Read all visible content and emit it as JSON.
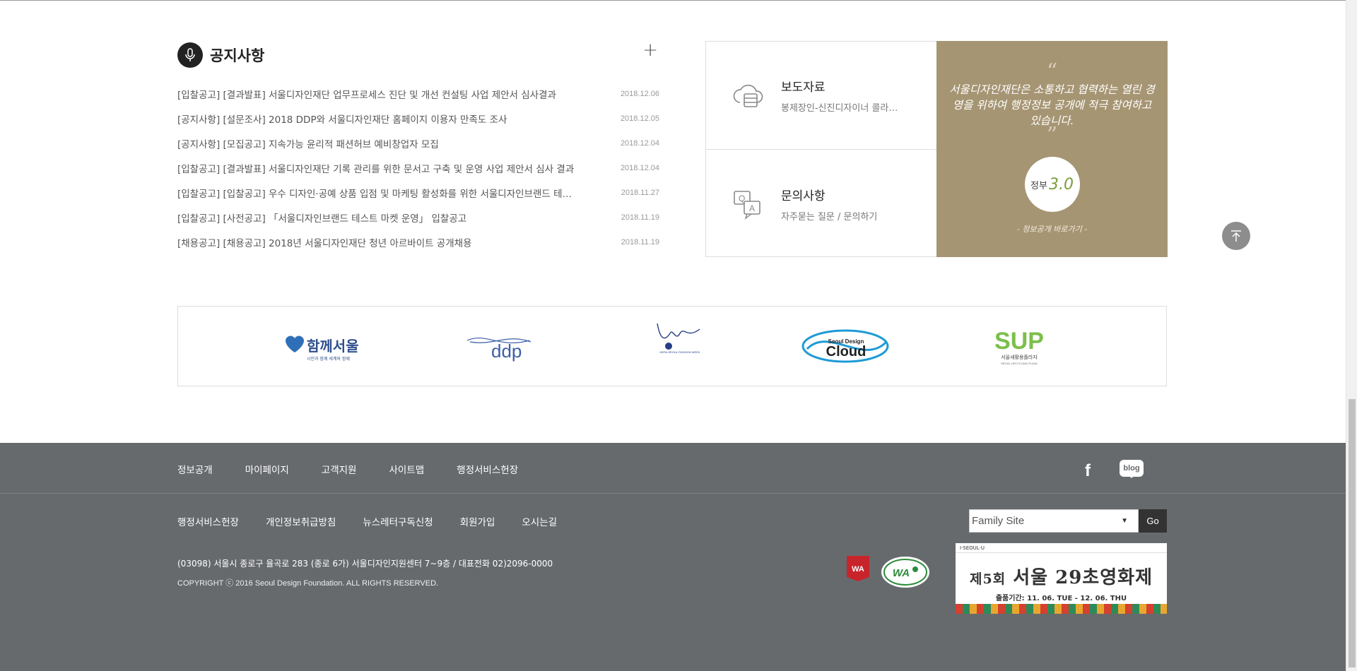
{
  "notice": {
    "title": "공지사항",
    "items": [
      {
        "text": "[입찰공고] [결과발표] 서울디자인재단 업무프로세스 진단 및 개선 컨설팅 사업 제안서 심사결과",
        "date": "2018.12.06"
      },
      {
        "text": "[공지사항] [설문조사] 2018 DDP와 서울디자인재단 홈페이지 이용자 만족도 조사",
        "date": "2018.12.05"
      },
      {
        "text": "[공지사항] [모집공고] 지속가능 윤리적 패션허브 예비창업자 모집",
        "date": "2018.12.04"
      },
      {
        "text": "[입찰공고] [결과발표] 서울디자인재단 기록 관리를 위한 문서고 구축 및 운영 사업 제안서 심사 결과",
        "date": "2018.12.04"
      },
      {
        "text": "[입찰공고] [입찰공고] 우수 디자인·공예 상품 입점 및 마케팅 활성화를 위한 서울디자인브랜드 테…",
        "date": "2018.11.27"
      },
      {
        "text": "[입찰공고] [사전공고] 「서울디자인브랜드 테스트 마켓 운영」 입찰공고",
        "date": "2018.11.19"
      },
      {
        "text": "[채용공고] [채용공고] 2018년 서울디자인재단 청년 아르바이트 공개채용",
        "date": "2018.11.19"
      }
    ]
  },
  "press": {
    "title": "보도자료",
    "subtitle": "봉제장인-신진디자이너 콜라…"
  },
  "inquiry": {
    "title": "문의사항",
    "subtitle": "자주묻는 질문 / 문의하기"
  },
  "open_info": {
    "quote": "서울디자인재단은 소통하고 협력하는 열린 경영을 위하여 행정정보 공개에 적극 참여하고 있습니다.",
    "badge_text": "정부",
    "badge_version": "3.0",
    "link": "- 정보공개 바로가기 -"
  },
  "logos": {
    "together_seoul": "함께서울",
    "together_sub": "시민과 함께 세계와 함께",
    "ddp": "ddp",
    "hera": "HERA SEOUL FASHION WEEK",
    "cloud_top": "Seoul Design",
    "cloud_main": "Cloud",
    "sup": "SUP",
    "sup_ko": "서울새활용플라자",
    "sup_en": "SEOUL UPCYCLING PLAZA"
  },
  "footer": {
    "nav_main": [
      "정보공개",
      "마이페이지",
      "고객지원",
      "사이트맵",
      "행정서비스헌장"
    ],
    "nav_sub": [
      "행정서비스헌장",
      "개인정보취급방침",
      "뉴스레터구독신청",
      "회원가입",
      "오시는길"
    ],
    "blog": "blog",
    "address": "(03098) 서울시 종로구 율곡로 283 (종로 6가) 서울디자인지원센터 7~9층 / 대표전화 02)2096-0000",
    "copyright": "COPYRIGHT ⓒ 2016 Seoul Design Foundation. ALL RIGHTS RESERVED.",
    "family_site": "Family Site",
    "go": "Go",
    "banner": {
      "brand": "I·SEOUL·U",
      "title_a": "제5회",
      "title_b": "서울 29초영화제",
      "date": "출품기간: 11. 06. TUE - 12. 06. THU"
    }
  }
}
